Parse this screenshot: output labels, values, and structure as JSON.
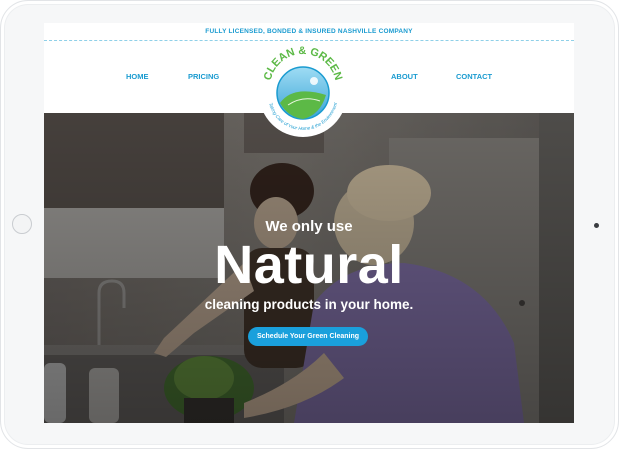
{
  "topbar": {
    "text": "FULLY LICENSED, BONDED & INSURED NASHVILLE COMPANY"
  },
  "nav": {
    "home": "HOME",
    "pricing": "PRICING",
    "about": "ABOUT",
    "contact": "CONTACT"
  },
  "logo": {
    "name": "CLEAN & GREEN",
    "tagline": "Taking Care of Your Home & the Environment"
  },
  "hero": {
    "subheading": "We only use",
    "heading": "Natural",
    "description": "cleaning products in your home.",
    "cta_label": "Schedule Your Green Cleaning"
  },
  "colors": {
    "brand_blue": "#1a9bd0",
    "brand_green": "#5cb946",
    "cta_blue": "#1aa0dc"
  }
}
